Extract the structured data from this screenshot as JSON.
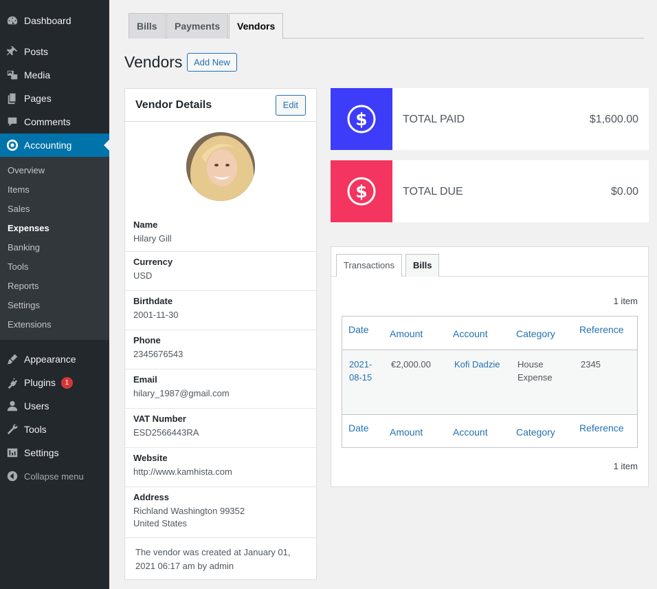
{
  "sidebar": {
    "items_top": [
      {
        "label": "Dashboard",
        "icon": "dashboard-icon"
      },
      {
        "label": "Posts",
        "icon": "pin-icon"
      },
      {
        "label": "Media",
        "icon": "media-icon"
      },
      {
        "label": "Pages",
        "icon": "pages-icon"
      },
      {
        "label": "Comments",
        "icon": "comment-icon"
      },
      {
        "label": "Accounting",
        "icon": "accounting-icon"
      }
    ],
    "submenu": [
      "Overview",
      "Items",
      "Sales",
      "Expenses",
      "Banking",
      "Tools",
      "Reports",
      "Settings",
      "Extensions"
    ],
    "items_bottom": [
      {
        "label": "Appearance",
        "icon": "brush-icon"
      },
      {
        "label": "Plugins",
        "icon": "plugin-icon",
        "badge": "1"
      },
      {
        "label": "Users",
        "icon": "users-icon"
      },
      {
        "label": "Tools",
        "icon": "wrench-icon"
      },
      {
        "label": "Settings",
        "icon": "settings-icon"
      }
    ],
    "collapse": "Collapse menu"
  },
  "tabs": [
    "Bills",
    "Payments",
    "Vendors"
  ],
  "page": {
    "title": "Vendors",
    "add_new": "Add New"
  },
  "vendor": {
    "card_title": "Vendor Details",
    "edit": "Edit",
    "fields": [
      {
        "label": "Name",
        "value": "Hilary Gill"
      },
      {
        "label": "Currency",
        "value": "USD"
      },
      {
        "label": "Birthdate",
        "value": "2001-11-30"
      },
      {
        "label": "Phone",
        "value": "2345676543"
      },
      {
        "label": "Email",
        "value": "hilary_1987@gmail.com"
      },
      {
        "label": "VAT Number",
        "value": "ESD2566443RA"
      },
      {
        "label": "Website",
        "value": "http://www.kamhista.com"
      },
      {
        "label": "Address",
        "value": "Richland Washington 99352",
        "value2": "United States"
      }
    ],
    "created_line1": "The vendor was created at January 01,",
    "created_line2": "2021 06:17 am by admin"
  },
  "stats": [
    {
      "label": "TOTAL PAID",
      "value": "$1,600.00",
      "color": "#3d3cf8"
    },
    {
      "label": "TOTAL DUE",
      "value": "$0.00",
      "color": "#f3355f"
    }
  ],
  "transactions": {
    "tabs": [
      "Transactions",
      "Bills"
    ],
    "count_top": "1 item",
    "count_bottom": "1 item",
    "columns": [
      "Date",
      "Amount",
      "Account",
      "Category",
      "Reference"
    ],
    "row": {
      "date1": "2021-",
      "date2": "08-15",
      "amount": "€2,000.00",
      "account": "Kofi Dadzie",
      "category1": "House",
      "category2": "Expense",
      "reference": "2345"
    }
  }
}
